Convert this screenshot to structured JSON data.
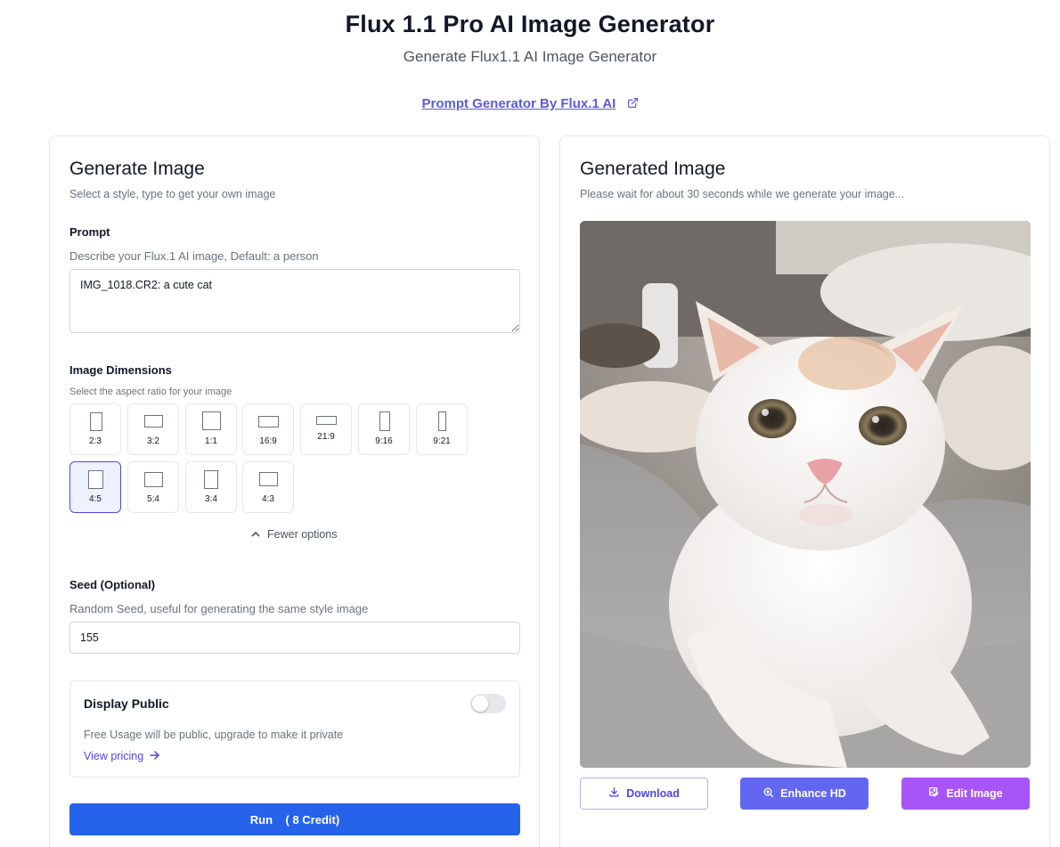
{
  "header": {
    "title": "Flux 1.1 Pro AI Image Generator",
    "subtitle": "Generate Flux1.1 AI Image Generator",
    "prompt_link": "Prompt Generator By Flux.1 AI"
  },
  "left": {
    "title": "Generate Image",
    "description": "Select a style, type to get your own image",
    "prompt": {
      "label": "Prompt",
      "help": "Describe your Flux.1 AI image, Default: a person",
      "value": "IMG_1018.CR2: a cute cat"
    },
    "dimensions": {
      "label": "Image Dimensions",
      "help": "Select the aspect ratio for your image",
      "options": [
        "2:3",
        "3:2",
        "1:1",
        "16:9",
        "21:9",
        "9:16",
        "9:21",
        "4:5",
        "5:4",
        "3:4",
        "4:3"
      ],
      "selected": "4:5",
      "toggle_label": "Fewer options"
    },
    "seed": {
      "label": "Seed (Optional)",
      "help": "Random Seed, useful for generating the same style image",
      "value": "155"
    },
    "public": {
      "title": "Display Public",
      "description": "Free Usage will be public, upgrade to make it private",
      "pricing_link": "View pricing",
      "enabled": false
    },
    "run_button": "Run    ( 8 Credit)"
  },
  "right": {
    "title": "Generated Image",
    "description": "Please wait for about 30 seconds while we generate your image...",
    "buttons": {
      "download": "Download",
      "enhance": "Enhance HD",
      "edit": "Edit Image"
    }
  },
  "colors": {
    "primary": "#2563eb",
    "indigo": "#6366f1",
    "purple": "#a855f7",
    "link": "#5b5bd6"
  }
}
